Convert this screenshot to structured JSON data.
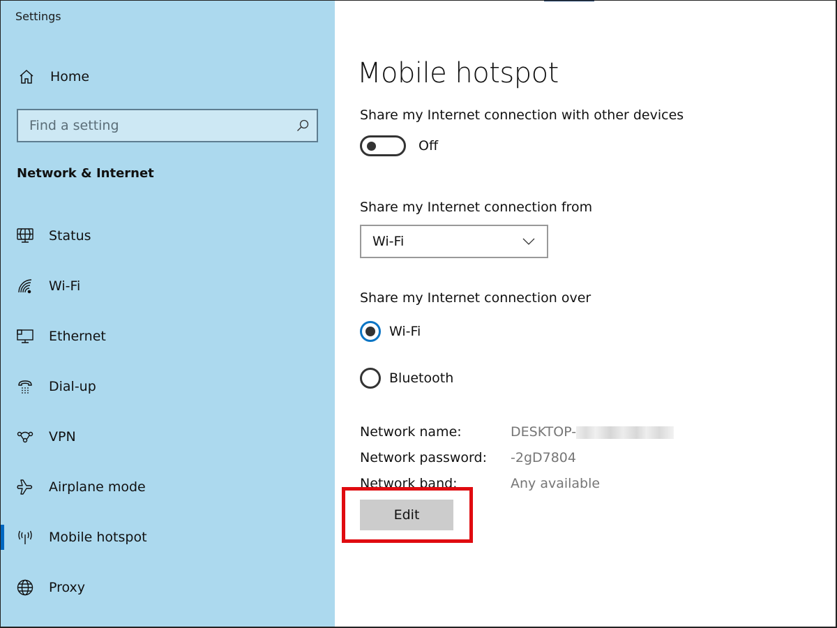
{
  "window": {
    "title": "Settings"
  },
  "sidebar": {
    "home_label": "Home",
    "search": {
      "placeholder": "Find a setting",
      "value": ""
    },
    "section_title": "Network & Internet",
    "items": [
      {
        "label": "Status",
        "icon": "status-globe-monitor-icon",
        "active": false
      },
      {
        "label": "Wi-Fi",
        "icon": "wifi-icon",
        "active": false
      },
      {
        "label": "Ethernet",
        "icon": "ethernet-icon",
        "active": false
      },
      {
        "label": "Dial-up",
        "icon": "dial-up-phone-icon",
        "active": false
      },
      {
        "label": "VPN",
        "icon": "vpn-icon",
        "active": false
      },
      {
        "label": "Airplane mode",
        "icon": "airplane-icon",
        "active": false
      },
      {
        "label": "Mobile hotspot",
        "icon": "mobile-hotspot-icon",
        "active": true
      },
      {
        "label": "Proxy",
        "icon": "globe-icon",
        "active": false
      }
    ],
    "accent_color": "#0067c0"
  },
  "main": {
    "title": "Mobile hotspot",
    "share_label": "Share my Internet connection with other devices",
    "share_toggle": {
      "state": "Off",
      "on": false
    },
    "share_from_label": "Share my Internet connection from",
    "share_from_value": "Wi-Fi",
    "share_over_label": "Share my Internet connection over",
    "share_over_options": [
      {
        "label": "Wi-Fi",
        "checked": true
      },
      {
        "label": "Bluetooth",
        "checked": false
      }
    ],
    "network_info": [
      {
        "label": "Network name:",
        "value": "DESKTOP-",
        "redacted": true
      },
      {
        "label": "Network password:",
        "value": "-2gD7804",
        "redacted": false
      },
      {
        "label": "Network band:",
        "value": "Any available",
        "redacted": false
      }
    ],
    "edit_button": "Edit",
    "highlight_color": "#e00b10"
  }
}
